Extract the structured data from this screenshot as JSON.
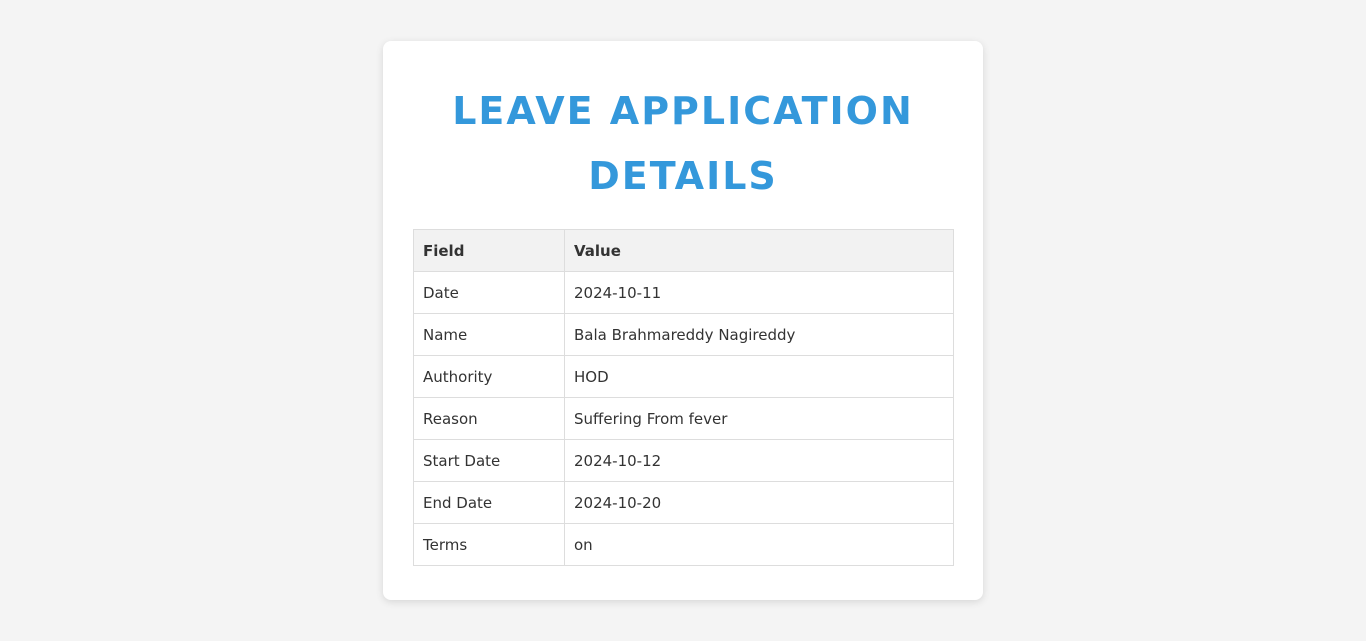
{
  "page": {
    "title": "LEAVE APPLICATION DETAILS",
    "accent_color": "#3498db"
  },
  "table": {
    "headers": [
      "Field",
      "Value"
    ],
    "rows": [
      {
        "field": "Date",
        "value": "2024-10-11"
      },
      {
        "field": "Name",
        "value": "Bala Brahmareddy Nagireddy"
      },
      {
        "field": "Authority",
        "value": "HOD"
      },
      {
        "field": "Reason",
        "value": "Suffering From fever"
      },
      {
        "field": "Start Date",
        "value": "2024-10-12"
      },
      {
        "field": "End Date",
        "value": "2024-10-20"
      },
      {
        "field": "Terms",
        "value": "on"
      }
    ]
  }
}
